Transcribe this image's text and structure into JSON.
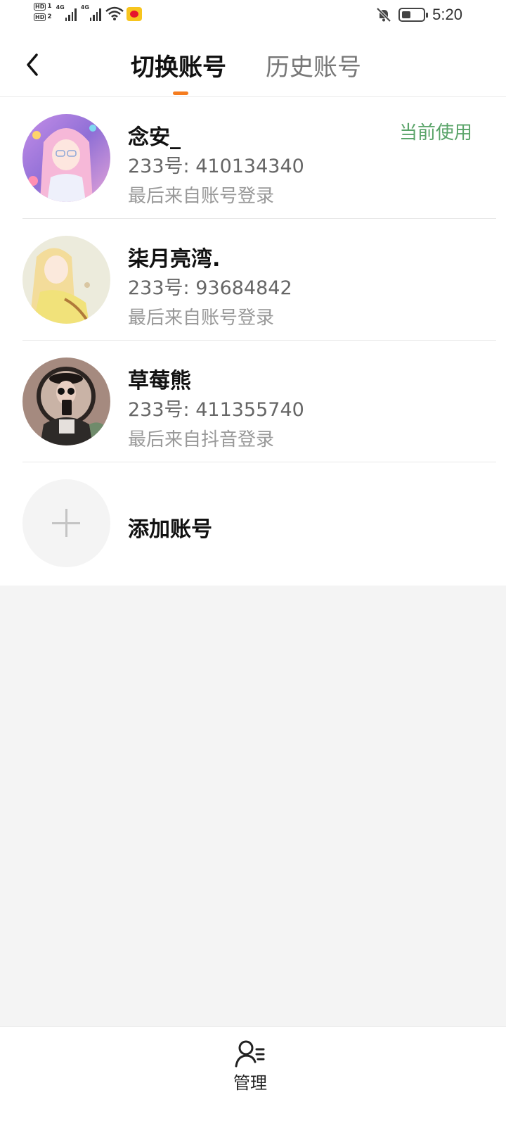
{
  "status_bar": {
    "sim1": "HD",
    "sim1_num": "1",
    "sim2": "HD",
    "sim2_num": "2",
    "network1": "4G",
    "network2": "4G",
    "time": "5:20",
    "icons": [
      "signal-icon",
      "wifi-icon",
      "weibo-app-icon",
      "mute-bell-icon",
      "battery-icon"
    ]
  },
  "header": {
    "back_icon": "chevron-left-icon",
    "tabs": [
      {
        "label": "切换账号",
        "active": true
      },
      {
        "label": "历史账号",
        "active": false
      }
    ],
    "indicator_color": "#f57c1f"
  },
  "accounts": [
    {
      "name": "念安_",
      "id_text": "233号: 410134340",
      "source": "最后来自账号登录",
      "badge": "当前使用"
    },
    {
      "name": "柒月亮湾.",
      "id_text": "233号: 93684842",
      "source": "最后来自账号登录"
    },
    {
      "name": "草莓熊",
      "id_text": "233号: 411355740",
      "source": "最后来自抖音登录"
    }
  ],
  "add_account": {
    "label": "添加账号",
    "icon": "plus-icon"
  },
  "bottom_bar": {
    "manage_label": "管理",
    "manage_icon": "manage-user-icon"
  },
  "colors": {
    "accent": "#f57c1f",
    "current_badge": "#5aa469",
    "background": "#f4f4f4"
  }
}
